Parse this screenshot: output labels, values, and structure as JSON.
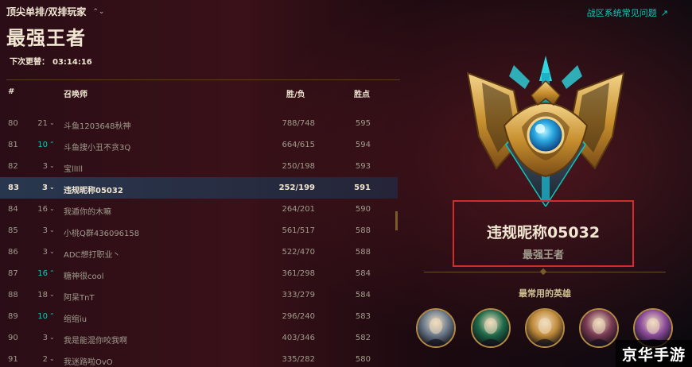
{
  "header": {
    "queue_label": "顶尖单排/双排玩家",
    "queue_chevron": "⌃⌄",
    "title": "最强王者",
    "next_update_label": "下次更替：",
    "next_update_time": "03:14:16",
    "faq_label": "战区系统常见问题",
    "faq_icon": "external-link-icon"
  },
  "table": {
    "headers": {
      "rank": "#",
      "summoner": "召唤师",
      "wl": "胜/负",
      "lp": "胜点"
    },
    "rows": [
      {
        "rank": "80",
        "change": "21",
        "dir": "down",
        "name": "斗鱼1203648秋神",
        "wl": "788/748",
        "lp": "595"
      },
      {
        "rank": "81",
        "change": "10",
        "dir": "up",
        "name": "斗鱼搜小丑不贪3Q",
        "wl": "664/615",
        "lp": "594"
      },
      {
        "rank": "82",
        "change": "3",
        "dir": "down",
        "name": "宝llIll",
        "wl": "250/198",
        "lp": "593"
      },
      {
        "rank": "83",
        "change": "3",
        "dir": "down",
        "name": "违规昵称05032",
        "wl": "252/199",
        "lp": "591"
      },
      {
        "rank": "84",
        "change": "16",
        "dir": "down",
        "name": "我遁你的木嘛",
        "wl": "264/201",
        "lp": "590"
      },
      {
        "rank": "85",
        "change": "3",
        "dir": "down",
        "name": "小桃Q群436096158",
        "wl": "561/517",
        "lp": "588"
      },
      {
        "rank": "86",
        "change": "3",
        "dir": "down",
        "name": "ADC想打职业丶",
        "wl": "522/470",
        "lp": "588"
      },
      {
        "rank": "87",
        "change": "16",
        "dir": "up",
        "name": "糖神很cool",
        "wl": "361/298",
        "lp": "584"
      },
      {
        "rank": "88",
        "change": "18",
        "dir": "down",
        "name": "阿呆TnT",
        "wl": "333/279",
        "lp": "584"
      },
      {
        "rank": "89",
        "change": "10",
        "dir": "up",
        "name": "绾绾iu",
        "wl": "296/240",
        "lp": "583"
      },
      {
        "rank": "90",
        "change": "3",
        "dir": "down",
        "name": "我是能混你咬我啊",
        "wl": "403/346",
        "lp": "582"
      },
      {
        "rank": "91",
        "change": "2",
        "dir": "down",
        "name": "我迷路啦OvO",
        "wl": "335/282",
        "lp": "580"
      }
    ],
    "highlight_rank": "83",
    "arrow_up": "⌃",
    "arrow_down": "⌄"
  },
  "profile": {
    "summoner_name": "违规昵称05032",
    "tier": "最强王者",
    "emblem_icon": "challenger-emblem-icon",
    "most_played_label": "最常用的英雄",
    "champions": [
      {
        "icon": "champion-portrait-1",
        "color": "#6b7a8c"
      },
      {
        "icon": "champion-portrait-2",
        "color": "#1f6b4a"
      },
      {
        "icon": "champion-portrait-3",
        "color": "#c08a3a"
      },
      {
        "icon": "champion-portrait-4",
        "color": "#7a3b55"
      },
      {
        "icon": "champion-portrait-5",
        "color": "#8a4a9a"
      }
    ]
  },
  "watermark": {
    "text": "京华手游"
  },
  "colors": {
    "gold": "#cdbe91",
    "teal": "#0ac8b9",
    "highlight_box": "#d32a2a",
    "row_highlight": "#2a3c55"
  }
}
